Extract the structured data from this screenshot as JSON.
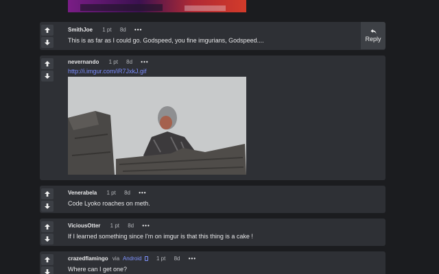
{
  "comments": [
    {
      "author": "SmithJoe",
      "points": "1 pt",
      "age": "8d",
      "text": "This is as far as I could go. Godspeed, you fine imgurians, Godspeed....",
      "reply_label": "Reply"
    },
    {
      "author": "nevernando",
      "points": "1 pt",
      "age": "8d",
      "link": "http://i.imgur.com/iR7JxkJ.gif"
    },
    {
      "author": "Venerabela",
      "points": "1 pt",
      "age": "8d",
      "text": "Code Lyoko roaches on meth."
    },
    {
      "author": "ViciousOtter",
      "points": "1 pt",
      "age": "8d",
      "text": "If I learned something since I'm on imgur is that this thing is a cake !"
    },
    {
      "author": "crazedflamingo",
      "via": "via",
      "platform": "Android",
      "points": "1 pt",
      "age": "8d",
      "text": "Where can I get one?"
    }
  ],
  "more_glyph": "•••",
  "icons": {
    "upvote": "arrow-up-icon",
    "downvote": "arrow-down-icon",
    "reply": "reply-icon",
    "device": "phone-icon"
  },
  "colors": {
    "background": "#1b1c1f",
    "card": "#2e3035",
    "link": "#7b8cff"
  }
}
